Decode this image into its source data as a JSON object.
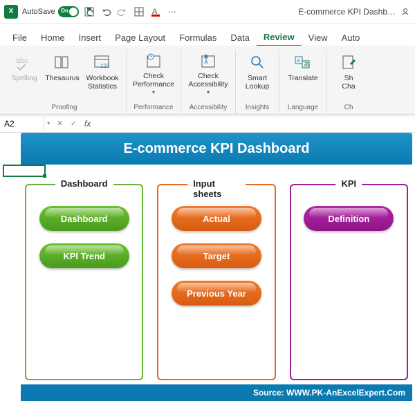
{
  "titlebar": {
    "autosave_label": "AutoSave",
    "autosave_state": "On",
    "doc_title": "E-commerce KPI Dashb…"
  },
  "tabs": {
    "items": [
      "File",
      "Home",
      "Insert",
      "Page Layout",
      "Formulas",
      "Data",
      "Review",
      "View",
      "Auto"
    ],
    "active_index": 6
  },
  "ribbon": {
    "groups": [
      {
        "label": "Proofing",
        "buttons": [
          {
            "name": "spelling-button",
            "label": "Spelling",
            "icon": "abc-check",
            "disabled": true
          },
          {
            "name": "thesaurus-button",
            "label": "Thesaurus",
            "icon": "book"
          },
          {
            "name": "workbook-statistics-button",
            "label": "Workbook\nStatistics",
            "icon": "stats"
          }
        ]
      },
      {
        "label": "Performance",
        "buttons": [
          {
            "name": "check-performance-button",
            "label": "Check\nPerformance",
            "icon": "clock-sheet",
            "dropdown": true
          }
        ]
      },
      {
        "label": "Accessibility",
        "buttons": [
          {
            "name": "check-accessibility-button",
            "label": "Check\nAccessibility",
            "icon": "person-sheet",
            "dropdown": true
          }
        ]
      },
      {
        "label": "Insights",
        "buttons": [
          {
            "name": "smart-lookup-button",
            "label": "Smart\nLookup",
            "icon": "magnify"
          }
        ]
      },
      {
        "label": "Language",
        "buttons": [
          {
            "name": "translate-button",
            "label": "Translate",
            "icon": "translate"
          }
        ]
      },
      {
        "label": "Ch",
        "buttons": [
          {
            "name": "show-changes-button",
            "label": "Sh\nCha",
            "icon": "sheet-edit"
          }
        ]
      }
    ]
  },
  "namebar": {
    "cell_ref": "A2",
    "fx_label": "fx"
  },
  "worksheet": {
    "banner_title": "E-commerce KPI Dashboard",
    "source_label": "Source: WWW.PK-AnExcelExpert.Com",
    "panels": [
      {
        "title": "Dashboard",
        "color": "green",
        "buttons": [
          {
            "name": "dashboard-pill",
            "label": "Dashboard"
          },
          {
            "name": "kpi-trend-pill",
            "label": "KPI Trend"
          }
        ]
      },
      {
        "title": "Input sheets",
        "color": "orange",
        "buttons": [
          {
            "name": "actual-pill",
            "label": "Actual"
          },
          {
            "name": "target-pill",
            "label": "Target"
          },
          {
            "name": "previous-year-pill",
            "label": "Previous Year"
          }
        ]
      },
      {
        "title": "KPI",
        "color": "purple",
        "buttons": [
          {
            "name": "definition-pill",
            "label": "Definition"
          }
        ]
      }
    ]
  }
}
